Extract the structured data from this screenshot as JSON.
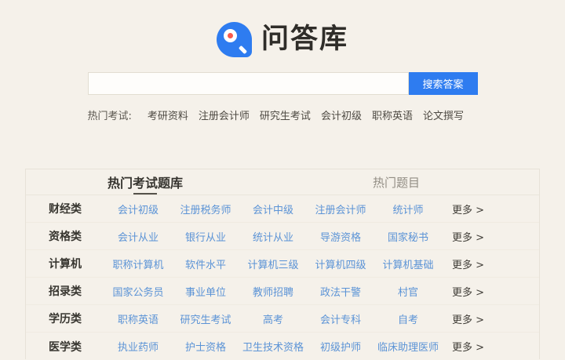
{
  "logo": {
    "text": "问答库"
  },
  "search": {
    "placeholder": "",
    "value": "",
    "button_label": "搜索答案"
  },
  "hot_exams": {
    "label": "热门考试:",
    "links": [
      "考研资料",
      "注册会计师",
      "研究生考试",
      "会计初级",
      "职称英语",
      "论文撰写"
    ]
  },
  "table": {
    "tabs": [
      {
        "label": "热门考试题库",
        "active": true
      },
      {
        "label": "热门题目",
        "active": false
      }
    ],
    "more_label": "更多 >",
    "rows": [
      {
        "category": "财经类",
        "links": [
          "会计初级",
          "注册税务师",
          "会计中级",
          "注册会计师",
          "统计师"
        ]
      },
      {
        "category": "资格类",
        "links": [
          "会计从业",
          "银行从业",
          "统计从业",
          "导游资格",
          "国家秘书"
        ]
      },
      {
        "category": "计算机",
        "links": [
          "职称计算机",
          "软件水平",
          "计算机三级",
          "计算机四级",
          "计算机基础"
        ]
      },
      {
        "category": "招录类",
        "links": [
          "国家公务员",
          "事业单位",
          "教师招聘",
          "政法干警",
          "村官"
        ]
      },
      {
        "category": "学历类",
        "links": [
          "职称英语",
          "研究生考试",
          "高考",
          "会计专科",
          "自考"
        ]
      },
      {
        "category": "医学类",
        "links": [
          "执业药师",
          "护士资格",
          "卫生技术资格",
          "初级护师",
          "临床助理医师"
        ]
      }
    ]
  },
  "colors": {
    "background": "#f5f1ea",
    "accent_blue": "#2e7cf0",
    "link_blue": "#5b93d6",
    "logo_red": "#f9594c"
  }
}
